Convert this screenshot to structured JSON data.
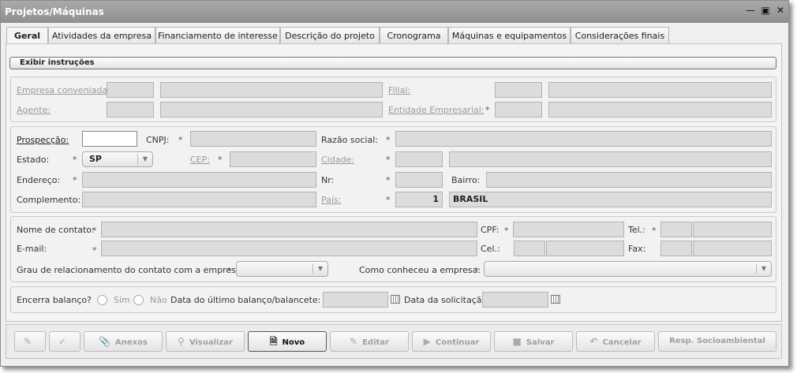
{
  "window": {
    "title": "Projetos/Máquinas"
  },
  "tabs": [
    "Geral",
    "Atividades da empresa",
    "Financiamento de interesse",
    "Descrição do projeto",
    "Cronograma",
    "Máquinas e equipamentos",
    "Considerações finais"
  ],
  "instructions_button": "Exibir instruções",
  "section1": {
    "empresa_label": "Empresa conveniada:",
    "agente_label": "Agente:",
    "filial_label": "Filial:",
    "entidade_label": "Entidade Empresarial:"
  },
  "section2": {
    "prospeccao_label": "Prospecção:",
    "cnpj_label": "CNPJ:",
    "razao_label": "Razão social:",
    "estado_label": "Estado:",
    "estado_value": "SP",
    "cep_label": "CEP:",
    "cidade_label": "Cidade:",
    "endereco_label": "Endereço:",
    "nr_label": "Nr:",
    "bairro_label": "Bairro:",
    "complemento_label": "Complemento:",
    "pais_label": "País:",
    "pais_code": "1",
    "pais_name": "BRASIL"
  },
  "section3": {
    "nome_label": "Nome de contato:",
    "email_label": "E-mail:",
    "cpf_label": "CPF:",
    "cel_label": "Cel.:",
    "tel_label": "Tel.:",
    "fax_label": "Fax:",
    "grau_label": "Grau de relacionamento do contato com a empresa:",
    "como_label": "Como conheceu a empresa:"
  },
  "section4": {
    "encerra_label": "Encerra balanço?",
    "sim_label": "Sim",
    "nao_label": "Não",
    "data_balanco_label": "Data do último balanço/balancete:",
    "data_solicitacao_label": "Data da solicitação:"
  },
  "required_mark": "*",
  "footer_buttons": {
    "anexos": "Anexos",
    "visualizar": "Visualizar",
    "novo": "Novo",
    "editar": "Editar",
    "continuar": "Continuar",
    "salvar": "Salvar",
    "cancelar": "Cancelar",
    "resp": "Resp. Socioambiental"
  },
  "icons": {
    "minimize": "minimize-icon",
    "maximize": "maximize-icon",
    "close": "close-icon"
  }
}
